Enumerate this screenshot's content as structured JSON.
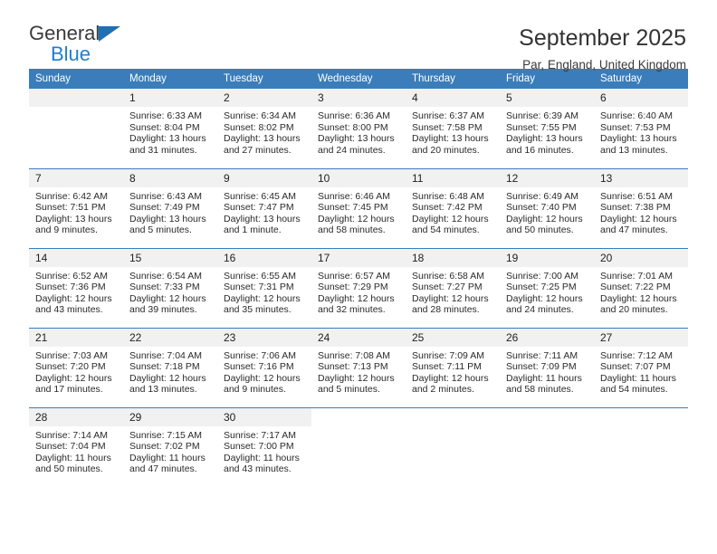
{
  "brand": {
    "name_part1": "General",
    "name_part2": "Blue",
    "triangle_color": "#1f6fb5",
    "blue_color": "#1f7fd0"
  },
  "header": {
    "title": "September 2025",
    "subtitle": "Par, England, United Kingdom"
  },
  "theme": {
    "header_bar": "#3a7dba",
    "daynum_bg": "#f1f1f1",
    "text": "#222222"
  },
  "weekday_headers": [
    "Sunday",
    "Monday",
    "Tuesday",
    "Wednesday",
    "Thursday",
    "Friday",
    "Saturday"
  ],
  "weeks": [
    [
      {
        "day": "",
        "sunrise": "",
        "sunset": "",
        "daylight_line1": "",
        "daylight_line2": "",
        "empty": true
      },
      {
        "day": "1",
        "sunrise": "Sunrise: 6:33 AM",
        "sunset": "Sunset: 8:04 PM",
        "daylight_line1": "Daylight: 13 hours",
        "daylight_line2": "and 31 minutes."
      },
      {
        "day": "2",
        "sunrise": "Sunrise: 6:34 AM",
        "sunset": "Sunset: 8:02 PM",
        "daylight_line1": "Daylight: 13 hours",
        "daylight_line2": "and 27 minutes."
      },
      {
        "day": "3",
        "sunrise": "Sunrise: 6:36 AM",
        "sunset": "Sunset: 8:00 PM",
        "daylight_line1": "Daylight: 13 hours",
        "daylight_line2": "and 24 minutes."
      },
      {
        "day": "4",
        "sunrise": "Sunrise: 6:37 AM",
        "sunset": "Sunset: 7:58 PM",
        "daylight_line1": "Daylight: 13 hours",
        "daylight_line2": "and 20 minutes."
      },
      {
        "day": "5",
        "sunrise": "Sunrise: 6:39 AM",
        "sunset": "Sunset: 7:55 PM",
        "daylight_line1": "Daylight: 13 hours",
        "daylight_line2": "and 16 minutes."
      },
      {
        "day": "6",
        "sunrise": "Sunrise: 6:40 AM",
        "sunset": "Sunset: 7:53 PM",
        "daylight_line1": "Daylight: 13 hours",
        "daylight_line2": "and 13 minutes."
      }
    ],
    [
      {
        "day": "7",
        "sunrise": "Sunrise: 6:42 AM",
        "sunset": "Sunset: 7:51 PM",
        "daylight_line1": "Daylight: 13 hours",
        "daylight_line2": "and 9 minutes."
      },
      {
        "day": "8",
        "sunrise": "Sunrise: 6:43 AM",
        "sunset": "Sunset: 7:49 PM",
        "daylight_line1": "Daylight: 13 hours",
        "daylight_line2": "and 5 minutes."
      },
      {
        "day": "9",
        "sunrise": "Sunrise: 6:45 AM",
        "sunset": "Sunset: 7:47 PM",
        "daylight_line1": "Daylight: 13 hours",
        "daylight_line2": "and 1 minute."
      },
      {
        "day": "10",
        "sunrise": "Sunrise: 6:46 AM",
        "sunset": "Sunset: 7:45 PM",
        "daylight_line1": "Daylight: 12 hours",
        "daylight_line2": "and 58 minutes."
      },
      {
        "day": "11",
        "sunrise": "Sunrise: 6:48 AM",
        "sunset": "Sunset: 7:42 PM",
        "daylight_line1": "Daylight: 12 hours",
        "daylight_line2": "and 54 minutes."
      },
      {
        "day": "12",
        "sunrise": "Sunrise: 6:49 AM",
        "sunset": "Sunset: 7:40 PM",
        "daylight_line1": "Daylight: 12 hours",
        "daylight_line2": "and 50 minutes."
      },
      {
        "day": "13",
        "sunrise": "Sunrise: 6:51 AM",
        "sunset": "Sunset: 7:38 PM",
        "daylight_line1": "Daylight: 12 hours",
        "daylight_line2": "and 47 minutes."
      }
    ],
    [
      {
        "day": "14",
        "sunrise": "Sunrise: 6:52 AM",
        "sunset": "Sunset: 7:36 PM",
        "daylight_line1": "Daylight: 12 hours",
        "daylight_line2": "and 43 minutes."
      },
      {
        "day": "15",
        "sunrise": "Sunrise: 6:54 AM",
        "sunset": "Sunset: 7:33 PM",
        "daylight_line1": "Daylight: 12 hours",
        "daylight_line2": "and 39 minutes."
      },
      {
        "day": "16",
        "sunrise": "Sunrise: 6:55 AM",
        "sunset": "Sunset: 7:31 PM",
        "daylight_line1": "Daylight: 12 hours",
        "daylight_line2": "and 35 minutes."
      },
      {
        "day": "17",
        "sunrise": "Sunrise: 6:57 AM",
        "sunset": "Sunset: 7:29 PM",
        "daylight_line1": "Daylight: 12 hours",
        "daylight_line2": "and 32 minutes."
      },
      {
        "day": "18",
        "sunrise": "Sunrise: 6:58 AM",
        "sunset": "Sunset: 7:27 PM",
        "daylight_line1": "Daylight: 12 hours",
        "daylight_line2": "and 28 minutes."
      },
      {
        "day": "19",
        "sunrise": "Sunrise: 7:00 AM",
        "sunset": "Sunset: 7:25 PM",
        "daylight_line1": "Daylight: 12 hours",
        "daylight_line2": "and 24 minutes."
      },
      {
        "day": "20",
        "sunrise": "Sunrise: 7:01 AM",
        "sunset": "Sunset: 7:22 PM",
        "daylight_line1": "Daylight: 12 hours",
        "daylight_line2": "and 20 minutes."
      }
    ],
    [
      {
        "day": "21",
        "sunrise": "Sunrise: 7:03 AM",
        "sunset": "Sunset: 7:20 PM",
        "daylight_line1": "Daylight: 12 hours",
        "daylight_line2": "and 17 minutes."
      },
      {
        "day": "22",
        "sunrise": "Sunrise: 7:04 AM",
        "sunset": "Sunset: 7:18 PM",
        "daylight_line1": "Daylight: 12 hours",
        "daylight_line2": "and 13 minutes."
      },
      {
        "day": "23",
        "sunrise": "Sunrise: 7:06 AM",
        "sunset": "Sunset: 7:16 PM",
        "daylight_line1": "Daylight: 12 hours",
        "daylight_line2": "and 9 minutes."
      },
      {
        "day": "24",
        "sunrise": "Sunrise: 7:08 AM",
        "sunset": "Sunset: 7:13 PM",
        "daylight_line1": "Daylight: 12 hours",
        "daylight_line2": "and 5 minutes."
      },
      {
        "day": "25",
        "sunrise": "Sunrise: 7:09 AM",
        "sunset": "Sunset: 7:11 PM",
        "daylight_line1": "Daylight: 12 hours",
        "daylight_line2": "and 2 minutes."
      },
      {
        "day": "26",
        "sunrise": "Sunrise: 7:11 AM",
        "sunset": "Sunset: 7:09 PM",
        "daylight_line1": "Daylight: 11 hours",
        "daylight_line2": "and 58 minutes."
      },
      {
        "day": "27",
        "sunrise": "Sunrise: 7:12 AM",
        "sunset": "Sunset: 7:07 PM",
        "daylight_line1": "Daylight: 11 hours",
        "daylight_line2": "and 54 minutes."
      }
    ],
    [
      {
        "day": "28",
        "sunrise": "Sunrise: 7:14 AM",
        "sunset": "Sunset: 7:04 PM",
        "daylight_line1": "Daylight: 11 hours",
        "daylight_line2": "and 50 minutes."
      },
      {
        "day": "29",
        "sunrise": "Sunrise: 7:15 AM",
        "sunset": "Sunset: 7:02 PM",
        "daylight_line1": "Daylight: 11 hours",
        "daylight_line2": "and 47 minutes."
      },
      {
        "day": "30",
        "sunrise": "Sunrise: 7:17 AM",
        "sunset": "Sunset: 7:00 PM",
        "daylight_line1": "Daylight: 11 hours",
        "daylight_line2": "and 43 minutes."
      },
      {
        "day": "",
        "sunrise": "",
        "sunset": "",
        "daylight_line1": "",
        "daylight_line2": "",
        "empty": true,
        "noshade": true
      },
      {
        "day": "",
        "sunrise": "",
        "sunset": "",
        "daylight_line1": "",
        "daylight_line2": "",
        "empty": true,
        "noshade": true
      },
      {
        "day": "",
        "sunrise": "",
        "sunset": "",
        "daylight_line1": "",
        "daylight_line2": "",
        "empty": true,
        "noshade": true
      },
      {
        "day": "",
        "sunrise": "",
        "sunset": "",
        "daylight_line1": "",
        "daylight_line2": "",
        "empty": true,
        "noshade": true
      }
    ]
  ]
}
